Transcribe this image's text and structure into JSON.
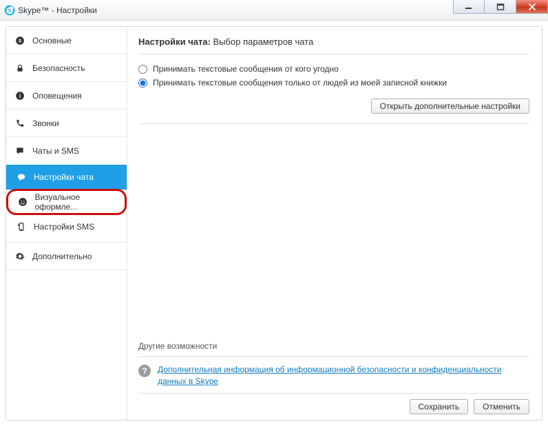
{
  "window": {
    "title": "Skype™ - Настройки"
  },
  "sidebar": {
    "items": [
      {
        "label": "Основные"
      },
      {
        "label": "Безопасность"
      },
      {
        "label": "Оповещения"
      },
      {
        "label": "Звонки"
      },
      {
        "label": "Чаты и SMS"
      },
      {
        "label": "Настройки чата"
      },
      {
        "label": "Визуальное оформле..."
      },
      {
        "label": "Настройки SMS"
      },
      {
        "label": "Дополнительно"
      }
    ]
  },
  "main": {
    "heading_strong": "Настройки чата:",
    "heading_rest": "Выбор параметров чата",
    "radio_anyone": "Принимать текстовые сообщения от кого угодно",
    "radio_contacts": "Принимать текстовые сообщения только от людей из моей записной книжки",
    "open_advanced": "Открыть дополнительные настройки",
    "other_heading": "Другие возможности",
    "info_link": "Дополнительная информация об информационной безопасности и конфиденциальности данных в Skype",
    "save": "Сохранить",
    "cancel": "Отменить"
  }
}
